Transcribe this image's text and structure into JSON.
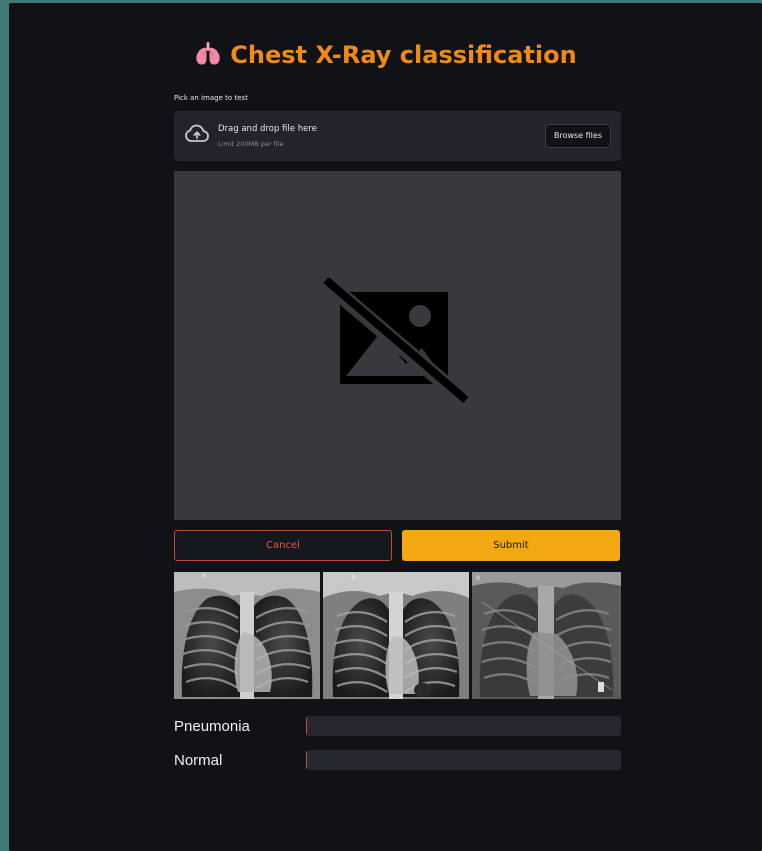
{
  "app": {
    "title": "Chest X-Ray classification",
    "title_icon": "lungs-icon",
    "accent_color": "#ef8a14"
  },
  "uploader": {
    "label": "Pick an image to test",
    "drag_text": "Drag and drop file here",
    "limit_text": "Limit 200MB per file",
    "browse_label": "Browse files",
    "icon": "cloud-upload-icon"
  },
  "preview": {
    "icon": "broken-image-icon"
  },
  "actions": {
    "cancel_label": "Cancel",
    "submit_label": "Submit",
    "cancel_color": "#c7473a",
    "submit_color": "#f3a712"
  },
  "examples": {
    "images": [
      {
        "marker": "R"
      },
      {
        "marker": "R"
      },
      {
        "marker": "R"
      }
    ]
  },
  "results": [
    {
      "label": "Pneumonia",
      "value": 0.0
    },
    {
      "label": "Normal",
      "value": 0.0
    }
  ]
}
